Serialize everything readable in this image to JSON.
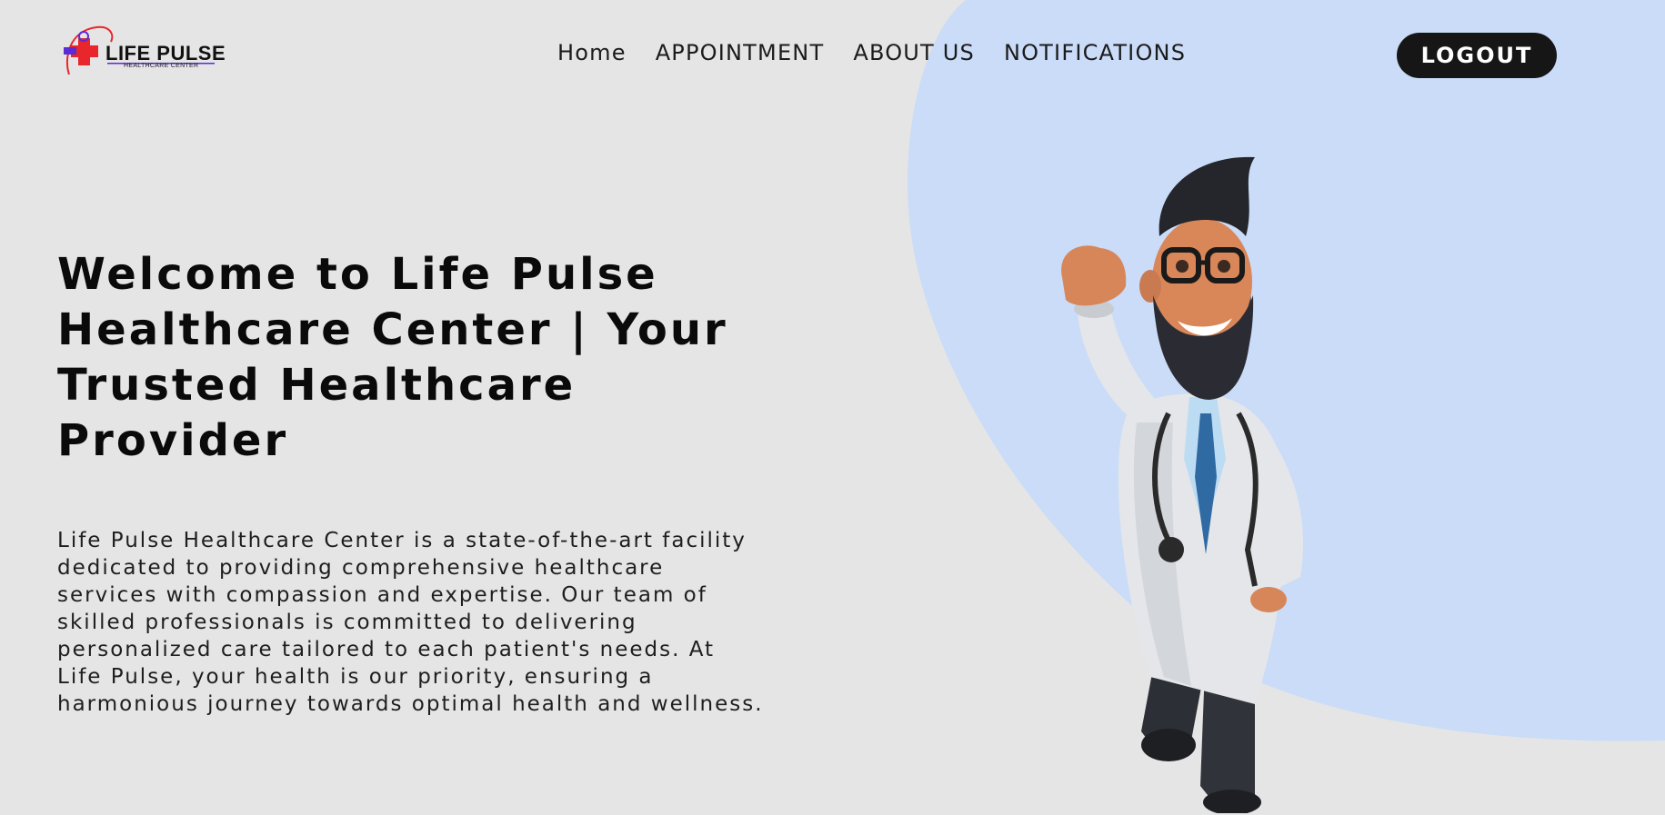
{
  "brand": {
    "name": "LIFE PULSE",
    "tagline": "HEALTHCARE CENTER"
  },
  "nav": {
    "items": [
      "Home",
      "APPOINTMENT",
      "ABOUT US",
      "NOTIFICATIONS"
    ],
    "logout_label": "LOGOUT"
  },
  "hero": {
    "title": "Welcome to Life Pulse Healthcare Center | Your Trusted Healthcare Provider",
    "description": "Life Pulse Healthcare Center is a state-of-the-art facility dedicated to providing comprehensive healthcare services with compassion and expertise. Our team of skilled professionals is committed to delivering personalized care tailored to each patient's needs. At Life Pulse, your health is our priority, ensuring a harmonious journey towards optimal health and wellness.",
    "illustration": "cartoon-doctor-illustration"
  },
  "colors": {
    "background": "#e5e5e5",
    "blob": "#cadcf8",
    "logout_bg": "#161616",
    "logo_red": "#e8262b",
    "logo_purple": "#5b2bd6"
  }
}
